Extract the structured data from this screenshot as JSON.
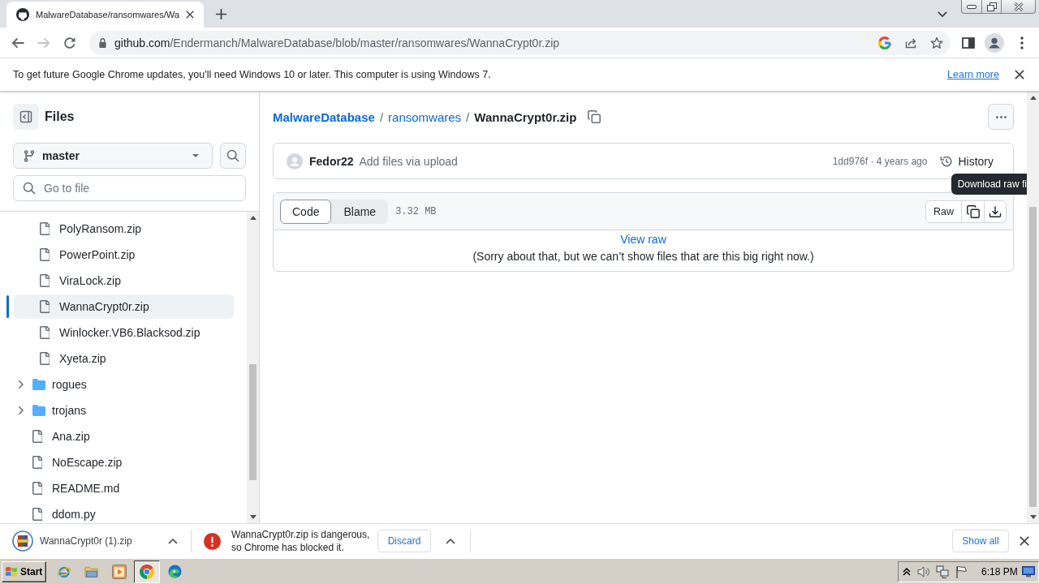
{
  "browser": {
    "tabs": [
      {
        "title": "MalwareDatabase/ransomwares/Wa",
        "selected": true
      }
    ],
    "nav_buttons": [
      {
        "kind": "back",
        "disabled": false
      },
      {
        "kind": "forward",
        "disabled": true
      },
      {
        "kind": "reload",
        "disabled": false
      }
    ],
    "address": {
      "host": "github.com",
      "path": "/Endermanch/MalwareDatabase/blob/master/ransomwares/WannaCrypt0r.zip"
    },
    "infobar": {
      "message": "To get future Google Chrome updates, you'll need Windows 10 or later. This computer is using Windows 7.",
      "link": "Learn more"
    }
  },
  "sidebar": {
    "title": "Files",
    "branch": "master",
    "search": {
      "placeholder": "Go to file"
    },
    "tree": [
      {
        "children": [
          {
            "kind": "file",
            "name": "PolyRansom.zip",
            "selected": false
          },
          {
            "kind": "file",
            "name": "PowerPoint.zip",
            "selected": false
          },
          {
            "kind": "file",
            "name": "ViraLock.zip",
            "selected": false
          },
          {
            "kind": "file",
            "name": "WannaCrypt0r.zip",
            "selected": true
          },
          {
            "kind": "file",
            "name": "Winlocker.VB6.Blacksod.zip",
            "selected": false
          },
          {
            "kind": "file",
            "name": "Xyeta.zip",
            "selected": false
          }
        ]
      },
      {
        "kind": "folder",
        "name": "rogues",
        "expanded": false,
        "selected": false
      },
      {
        "kind": "folder",
        "name": "trojans",
        "expanded": false,
        "selected": false
      },
      {
        "kind": "file",
        "name": "Ana.zip",
        "selected": false
      },
      {
        "kind": "file",
        "name": "NoEscape.zip",
        "selected": false
      },
      {
        "kind": "file",
        "name": "README.md",
        "selected": false
      },
      {
        "kind": "file",
        "name": "ddom.py",
        "selected": false
      }
    ]
  },
  "file_view": {
    "breadcrumbs": [
      {
        "label": "MalwareDatabase",
        "kind": "repo"
      },
      {
        "label": "ransomwares",
        "kind": "folder"
      },
      {
        "label": "WannaCrypt0r.zip",
        "kind": "file"
      }
    ],
    "separator": "/",
    "commit": {
      "author": "Fedor22",
      "message": "Add files via upload",
      "meta": "1dd976f · 4 years ago",
      "history": "History"
    },
    "views": [
      {
        "label": "Code",
        "selected": true
      },
      {
        "label": "Blame",
        "selected": false
      }
    ],
    "size": "3.32 MB",
    "raw_button": "Raw",
    "tooltip": "Download raw fi",
    "view_raw": "View raw",
    "notice": "(Sorry about that, but we can’t show files that are this big right now.)"
  },
  "downloads": {
    "items": [
      {
        "kind": "file",
        "name": "WannaCrypt0r (1).zip"
      },
      {
        "kind": "blocked",
        "lines": [
          "WannaCrypt0r.zip is dangerous,",
          "so Chrome has blocked it."
        ],
        "action": "Discard"
      }
    ],
    "show_all": "Show all"
  },
  "taskbar": {
    "start": "Start",
    "apps": [
      {
        "kind": "ring",
        "selected": false
      },
      {
        "kind": "folder",
        "selected": false
      },
      {
        "kind": "player",
        "selected": false
      },
      {
        "kind": "wheel",
        "selected": true
      },
      {
        "kind": "swirl",
        "selected": false
      }
    ],
    "clock": "6:18 PM"
  }
}
